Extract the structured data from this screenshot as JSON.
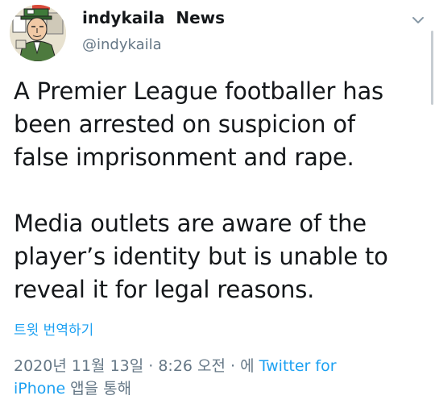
{
  "author": {
    "display_name": "indykaila  News",
    "handle": "@indykaila"
  },
  "tweet": {
    "text": "A Premier League footballer has\nbeen arrested on suspicion of\nfalse imprisonment and rape.\n\nMedia outlets are aware of the\nplayer’s identity but is unable to\nreveal it for legal reasons."
  },
  "translate_label": "트윗 번역하기",
  "meta": {
    "timestamp": "2020년 11월 13일 · 8:26 오전 · ",
    "via_prefix": "에 ",
    "source_line1": "Twitter for",
    "source_line2": "iPhone",
    "suffix": " 앱을 통해"
  },
  "icons": {
    "avatar": "cartoon-man-avatar",
    "menu": "chevron-down-icon"
  },
  "colors": {
    "link": "#1da1f2",
    "secondary_text": "#657786",
    "primary_text": "#14171a"
  }
}
